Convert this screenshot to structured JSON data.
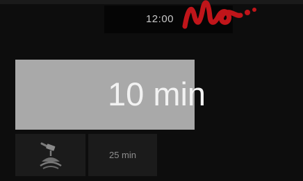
{
  "status_bar": {
    "time": "12:00"
  },
  "timer": {
    "value": "10 min"
  },
  "tiles": [
    {
      "icon": "roller-brush-icon"
    },
    {
      "label": "25 min"
    }
  ],
  "colors": {
    "background": "#0d0d0d",
    "panel": "#a9a9a9",
    "tile": "#1b1b1b",
    "watermark": "#c0151a"
  }
}
